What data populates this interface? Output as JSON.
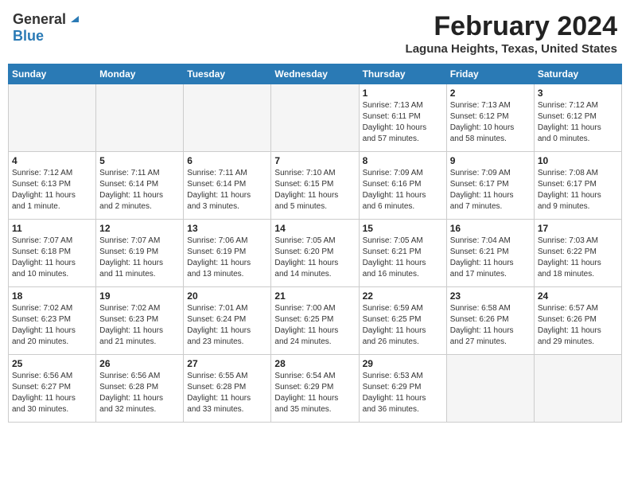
{
  "header": {
    "logo_general": "General",
    "logo_blue": "Blue",
    "title": "February 2024",
    "subtitle": "Laguna Heights, Texas, United States"
  },
  "days_of_week": [
    "Sunday",
    "Monday",
    "Tuesday",
    "Wednesday",
    "Thursday",
    "Friday",
    "Saturday"
  ],
  "weeks": [
    [
      {
        "num": "",
        "content": "",
        "empty": true
      },
      {
        "num": "",
        "content": "",
        "empty": true
      },
      {
        "num": "",
        "content": "",
        "empty": true
      },
      {
        "num": "",
        "content": "",
        "empty": true
      },
      {
        "num": "1",
        "content": "Sunrise: 7:13 AM\nSunset: 6:11 PM\nDaylight: 10 hours\nand 57 minutes.",
        "empty": false
      },
      {
        "num": "2",
        "content": "Sunrise: 7:13 AM\nSunset: 6:12 PM\nDaylight: 10 hours\nand 58 minutes.",
        "empty": false
      },
      {
        "num": "3",
        "content": "Sunrise: 7:12 AM\nSunset: 6:12 PM\nDaylight: 11 hours\nand 0 minutes.",
        "empty": false
      }
    ],
    [
      {
        "num": "4",
        "content": "Sunrise: 7:12 AM\nSunset: 6:13 PM\nDaylight: 11 hours\nand 1 minute.",
        "empty": false
      },
      {
        "num": "5",
        "content": "Sunrise: 7:11 AM\nSunset: 6:14 PM\nDaylight: 11 hours\nand 2 minutes.",
        "empty": false
      },
      {
        "num": "6",
        "content": "Sunrise: 7:11 AM\nSunset: 6:14 PM\nDaylight: 11 hours\nand 3 minutes.",
        "empty": false
      },
      {
        "num": "7",
        "content": "Sunrise: 7:10 AM\nSunset: 6:15 PM\nDaylight: 11 hours\nand 5 minutes.",
        "empty": false
      },
      {
        "num": "8",
        "content": "Sunrise: 7:09 AM\nSunset: 6:16 PM\nDaylight: 11 hours\nand 6 minutes.",
        "empty": false
      },
      {
        "num": "9",
        "content": "Sunrise: 7:09 AM\nSunset: 6:17 PM\nDaylight: 11 hours\nand 7 minutes.",
        "empty": false
      },
      {
        "num": "10",
        "content": "Sunrise: 7:08 AM\nSunset: 6:17 PM\nDaylight: 11 hours\nand 9 minutes.",
        "empty": false
      }
    ],
    [
      {
        "num": "11",
        "content": "Sunrise: 7:07 AM\nSunset: 6:18 PM\nDaylight: 11 hours\nand 10 minutes.",
        "empty": false
      },
      {
        "num": "12",
        "content": "Sunrise: 7:07 AM\nSunset: 6:19 PM\nDaylight: 11 hours\nand 11 minutes.",
        "empty": false
      },
      {
        "num": "13",
        "content": "Sunrise: 7:06 AM\nSunset: 6:19 PM\nDaylight: 11 hours\nand 13 minutes.",
        "empty": false
      },
      {
        "num": "14",
        "content": "Sunrise: 7:05 AM\nSunset: 6:20 PM\nDaylight: 11 hours\nand 14 minutes.",
        "empty": false
      },
      {
        "num": "15",
        "content": "Sunrise: 7:05 AM\nSunset: 6:21 PM\nDaylight: 11 hours\nand 16 minutes.",
        "empty": false
      },
      {
        "num": "16",
        "content": "Sunrise: 7:04 AM\nSunset: 6:21 PM\nDaylight: 11 hours\nand 17 minutes.",
        "empty": false
      },
      {
        "num": "17",
        "content": "Sunrise: 7:03 AM\nSunset: 6:22 PM\nDaylight: 11 hours\nand 18 minutes.",
        "empty": false
      }
    ],
    [
      {
        "num": "18",
        "content": "Sunrise: 7:02 AM\nSunset: 6:23 PM\nDaylight: 11 hours\nand 20 minutes.",
        "empty": false
      },
      {
        "num": "19",
        "content": "Sunrise: 7:02 AM\nSunset: 6:23 PM\nDaylight: 11 hours\nand 21 minutes.",
        "empty": false
      },
      {
        "num": "20",
        "content": "Sunrise: 7:01 AM\nSunset: 6:24 PM\nDaylight: 11 hours\nand 23 minutes.",
        "empty": false
      },
      {
        "num": "21",
        "content": "Sunrise: 7:00 AM\nSunset: 6:25 PM\nDaylight: 11 hours\nand 24 minutes.",
        "empty": false
      },
      {
        "num": "22",
        "content": "Sunrise: 6:59 AM\nSunset: 6:25 PM\nDaylight: 11 hours\nand 26 minutes.",
        "empty": false
      },
      {
        "num": "23",
        "content": "Sunrise: 6:58 AM\nSunset: 6:26 PM\nDaylight: 11 hours\nand 27 minutes.",
        "empty": false
      },
      {
        "num": "24",
        "content": "Sunrise: 6:57 AM\nSunset: 6:26 PM\nDaylight: 11 hours\nand 29 minutes.",
        "empty": false
      }
    ],
    [
      {
        "num": "25",
        "content": "Sunrise: 6:56 AM\nSunset: 6:27 PM\nDaylight: 11 hours\nand 30 minutes.",
        "empty": false
      },
      {
        "num": "26",
        "content": "Sunrise: 6:56 AM\nSunset: 6:28 PM\nDaylight: 11 hours\nand 32 minutes.",
        "empty": false
      },
      {
        "num": "27",
        "content": "Sunrise: 6:55 AM\nSunset: 6:28 PM\nDaylight: 11 hours\nand 33 minutes.",
        "empty": false
      },
      {
        "num": "28",
        "content": "Sunrise: 6:54 AM\nSunset: 6:29 PM\nDaylight: 11 hours\nand 35 minutes.",
        "empty": false
      },
      {
        "num": "29",
        "content": "Sunrise: 6:53 AM\nSunset: 6:29 PM\nDaylight: 11 hours\nand 36 minutes.",
        "empty": false
      },
      {
        "num": "",
        "content": "",
        "empty": true
      },
      {
        "num": "",
        "content": "",
        "empty": true
      }
    ]
  ]
}
